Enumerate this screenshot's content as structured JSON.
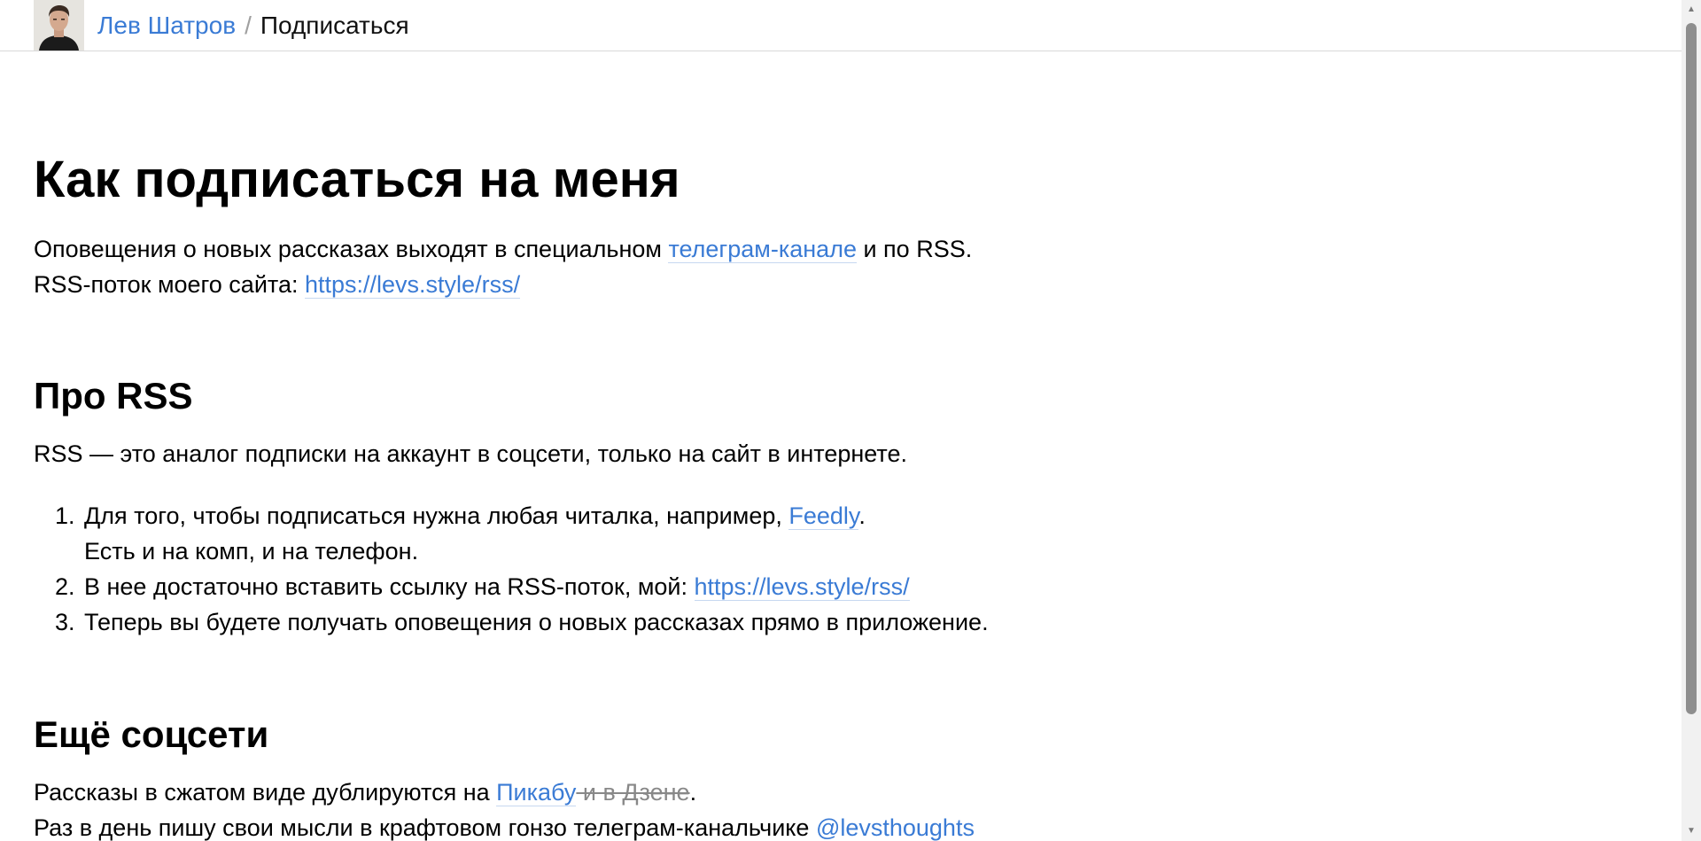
{
  "header": {
    "author_link": "Лев Шатров",
    "separator": "/",
    "current_page": "Подписаться"
  },
  "main": {
    "title": "Как подписаться на меня",
    "intro": {
      "line1_before": "Оповещения о новых рассказах выходят в специальном ",
      "line1_link": "телеграм-канале",
      "line1_after": " и по RSS.",
      "line2_before": "RSS-поток моего сайта: ",
      "line2_link": "https://levs.style/rss/"
    },
    "rss_section": {
      "heading": "Про RSS",
      "description": "RSS — это аналог подписки на аккаунт в соцсети, только на сайт в интернете.",
      "steps": [
        {
          "num": "1.",
          "before": "Для того, чтобы подписаться нужна любая читалка, например, ",
          "link": "Feedly",
          "after": ".",
          "line2": "Есть и на комп, и на телефон."
        },
        {
          "num": "2.",
          "before": "В нее достаточно вставить ссылку на RSS-поток, мой: ",
          "link": "https://levs.style/rss/"
        },
        {
          "num": "3.",
          "text": "Теперь вы будете получать оповещения о новых рассказах прямо в приложение."
        }
      ]
    },
    "social_section": {
      "heading": "Ещё соцсети",
      "line1_before": "Рассказы в сжатом виде дублируются на ",
      "line1_link": "Пикабу",
      "line1_strike": " и в Дзене",
      "line1_after": ".",
      "line2_before": "Раз в день пишу свои мысли в крафтовом гонзо телеграм-канальчике ",
      "line2_link": "@levsthoughts"
    }
  },
  "colors": {
    "link": "#3a7bd5",
    "text": "#000000",
    "strike": "#888888"
  }
}
